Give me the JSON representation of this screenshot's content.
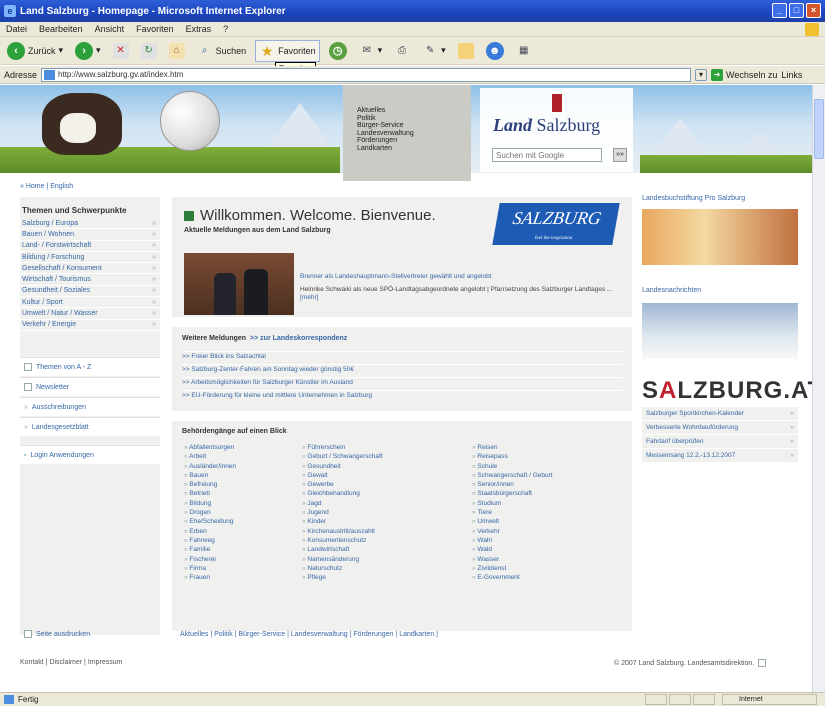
{
  "window": {
    "title": "Land Salzburg - Homepage - Microsoft Internet Explorer"
  },
  "menu": [
    "Datei",
    "Bearbeiten",
    "Ansicht",
    "Favoriten",
    "Extras",
    "?"
  ],
  "toolbar": {
    "back": "Zurück",
    "search": "Suchen",
    "favorites": "Favoriten",
    "tooltip": "Favoriten"
  },
  "address": {
    "label": "Adresse",
    "url": "http://www.salzburg.gv.at/index.htm",
    "go": "Wechseln zu",
    "links": "Links"
  },
  "quicknav": [
    "Aktuelles",
    "Politik",
    "Bürger-Service",
    "Landesverwaltung",
    "Förderungen",
    "Landkarten"
  ],
  "logo": {
    "land": "Land",
    "salzburg": "Salzburg"
  },
  "search": {
    "placeholder": "Suchen mit Google",
    "button": "»»"
  },
  "lang": "» Home | English",
  "left": {
    "heading": "Themen und Schwerpunkte",
    "items": [
      "Salzburg / Europa",
      "Bauen / Wohnen",
      "Land- / Forstwirtschaft",
      "Bildung / Forschung",
      "Gesellschaft / Konsument",
      "Wirtschaft / Tourismus",
      "Gesundheit / Soziales",
      "Kultur / Sport",
      "Umwelt / Natur / Wasser",
      "Verkehr / Energie"
    ],
    "boxes": [
      "Themen von A - Z",
      "Newsletter",
      "Ausschreibungen",
      "Landesgesetzblatt",
      "Login Anwendungen"
    ],
    "print": "Seite ausdrucken"
  },
  "welcome": {
    "title": "Willkommen. Welcome. Bienvenue.",
    "subtitle": "Aktuelle Meldungen aus dem Land Salzburg",
    "badge": "SALZBURG",
    "badge_sub": "feel the inspiration",
    "news_headline": "Brenner als Landeshauptmann-Stellvertreter gewählt und angelobt",
    "news_body": "Heinrike Schwaiki als neue SPÖ-Landtagsabgeordnete angelobt | Pfarrsetzung des Salzburger Landtages ...",
    "news_more": "[mehr]"
  },
  "more": {
    "heading": "Weitere Meldungen",
    "link": ">> zur Landeskorrespondenz",
    "items": [
      "Freier Blick ins Salzachtal",
      "Salzburg-Zenter-Fahren am Sonntag wieder günstig 50€",
      "Arbeitsmöglichkeiten für Salzburger Künstler im Ausland",
      "EU-Förderung für kleine und mittlere Unternehmen in Salzburg"
    ]
  },
  "beh": {
    "heading": "Behördengänge auf einen Blick",
    "col1": [
      "Abfallentsorgen",
      "Arbeit",
      "Ausländer/innen",
      "Bauen",
      "Befreiung",
      "Betrieb",
      "Bildung",
      "Drogen",
      "Ehe/Scheidung",
      "Erben",
      "Fahrweg",
      "Familie",
      "Fischerei",
      "Firma",
      "Frauen"
    ],
    "col2": [
      "Führerschein",
      "Geburt / Schwangerschaft",
      "Gesundheit",
      "Gewalt",
      "Gewerbe",
      "Gleichbehandlung",
      "Jagd",
      "Jugend",
      "Kinder",
      "Kirchenaustritt/auszahlt",
      "Konsumentenschutz",
      "Landwirtschaft",
      "Namensänderung",
      "Naturschutz",
      "Pflege"
    ],
    "col3": [
      "Reisen",
      "Reisepass",
      "Schule",
      "Schwangerschaft / Geburt",
      "Senior/innen",
      "Staatsbürgerschaft",
      "Studium",
      "Tiere",
      "Umwelt",
      "Verkehr",
      "Wahl",
      "Wald",
      "Wasser",
      "Zivildienst",
      "E-Government"
    ]
  },
  "bottom_nav": "Aktuelles  |  Politik  |  Bürger-Service  |  Landesverwaltung  |  Förderungen  |  Landkarten  |",
  "footer": {
    "left": "Kontakt  |  Disclaimer  |  Impressum",
    "right": "© 2007 Land Salzburg. Landesamtsdirektion."
  },
  "right": {
    "title1": "Landesbuchstiftung Pro Salzburg",
    "title2": "Landesnachrichten",
    "salz1": "S",
    "salzA": "A",
    "salz2": "LZBURG.AT",
    "items": [
      "Salzburger Sportkirchen-Kalender",
      "Verbesserte Wohnbauförderung",
      "Fahrtarif überprüfen",
      "Messeinsang 12.2.-13.12.2007"
    ]
  },
  "status": {
    "text": "Fertig",
    "zone": "Internet"
  }
}
